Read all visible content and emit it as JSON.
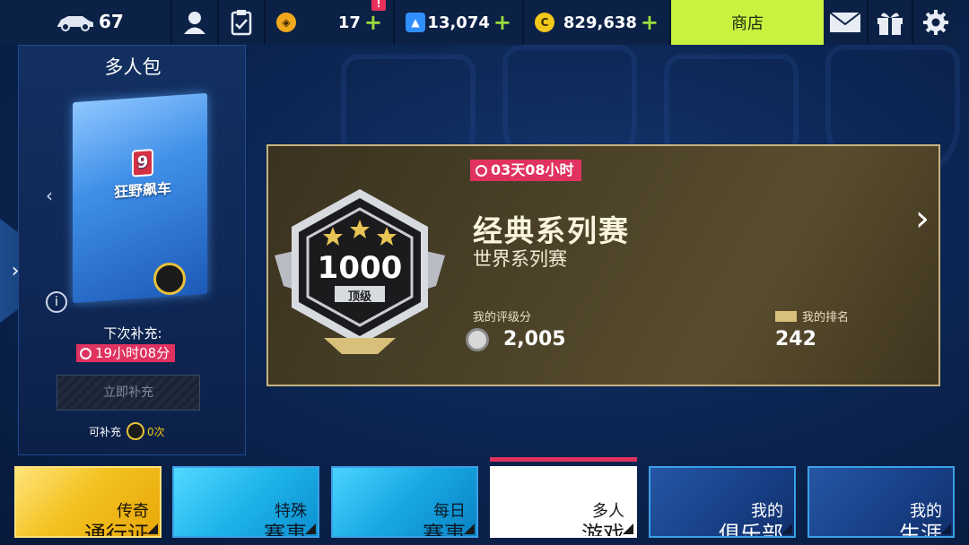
{
  "topbar": {
    "cars_count": "67",
    "resource1": {
      "amount": "17",
      "plus": "+",
      "alert": "!"
    },
    "resource2": {
      "amount": "13,074",
      "plus": "+"
    },
    "resource3": {
      "amount": "829,638",
      "plus": "+"
    },
    "shop_label": "商店"
  },
  "left_panel": {
    "title": "多人包",
    "pack_logo": "狂野飙车",
    "pack_number": "9",
    "refill_label": "下次补充:",
    "refill_timer": "19小时08分",
    "refill_button": "立即补充",
    "refill_count_prefix": "可补充",
    "refill_count_value": "0次"
  },
  "event": {
    "timer": "03天08小时",
    "badge_number": "1000",
    "badge_tier": "顶级",
    "title": "经典系列赛",
    "subtitle": "世界系列赛",
    "rating_label": "我的评级分",
    "rating_value": "2,005",
    "rank_label": "我的排名",
    "rank_value": "242"
  },
  "bottom_nav": {
    "legend": {
      "line1": "传奇",
      "line2": "通行证"
    },
    "special": {
      "line1": "特殊",
      "line2": "赛事"
    },
    "daily": {
      "line1": "每日",
      "line2": "赛事"
    },
    "multi": {
      "line1": "多人",
      "line2": "游戏"
    },
    "club": {
      "line1": "我的",
      "line2": "俱乐部"
    },
    "career": {
      "line1": "我的",
      "line2": "生涯"
    }
  },
  "colors": {
    "accent_green": "#c9f240",
    "timer_pink": "#e0325f",
    "gold": "#c6b280",
    "nav_blue": "#1fb4ea"
  },
  "icons": [
    "car-icon",
    "profile-icon",
    "clipboard-icon",
    "token-icon",
    "blueprint-icon",
    "credits-icon",
    "mail-icon",
    "gift-icon",
    "gear-icon",
    "info-icon",
    "clock-icon",
    "chevron-left-icon",
    "chevron-right-icon"
  ]
}
